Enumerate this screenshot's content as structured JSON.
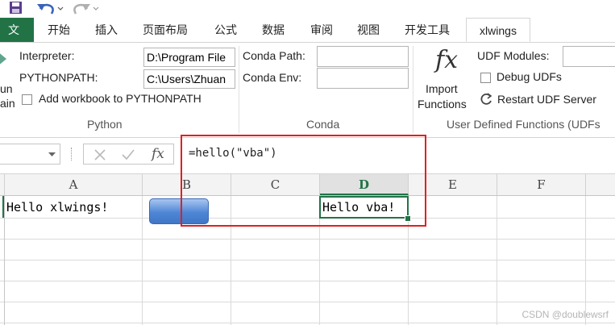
{
  "tabs": {
    "file": "文件",
    "items": [
      "开始",
      "插入",
      "页面布局",
      "公式",
      "数据",
      "审阅",
      "视图",
      "开发工具"
    ],
    "active": "xlwings"
  },
  "ribbon": {
    "run_fragment": "un\nain",
    "interpreter_label": "Interpreter:",
    "interpreter_value": "D:\\Program File",
    "pythonpath_label": "PYTHONPATH:",
    "pythonpath_value": "C:\\Users\\Zhuan",
    "add_workbook_label": "Add workbook to PYTHONPATH",
    "conda_path_label": "Conda Path:",
    "conda_env_label": "Conda Env:",
    "conda_path_value": "",
    "conda_env_value": "",
    "fx_glyph": "fx",
    "import_label": "Import",
    "functions_label": "Functions",
    "udf_modules_label": "UDF Modules:",
    "udf_modules_value": "",
    "debug_udfs_label": "Debug UDFs",
    "restart_label": "Restart UDF Server",
    "group_python": "Python",
    "group_conda": "Conda",
    "group_udf": "User Defined Functions (UDFs"
  },
  "formula_bar": {
    "name_box": "",
    "fx_glyph": "fx",
    "formula": "=hello(\"vba\")"
  },
  "sheet": {
    "columns": [
      "A",
      "B",
      "C",
      "D",
      "E",
      "F"
    ],
    "selected_column": "D",
    "cell_a1": "Hello xlwings!",
    "cell_d1": "Hello vba!"
  },
  "colors": {
    "excel_green": "#217346",
    "annotation_red": "#e02020",
    "shape_blue": "#4f86d6"
  },
  "watermark": "CSDN @doublewsrf"
}
